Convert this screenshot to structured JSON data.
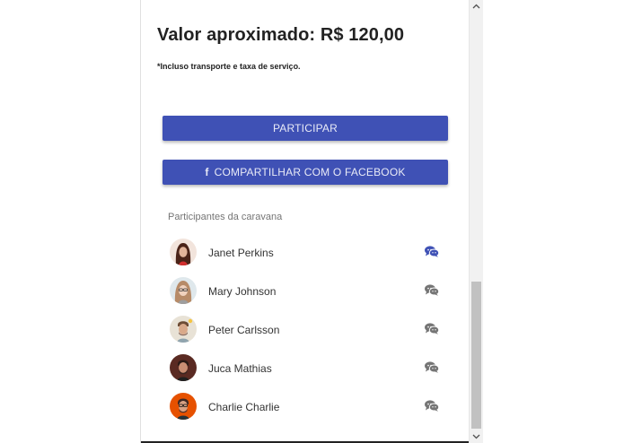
{
  "price": {
    "text": "Valor aproximado: R$ 120,00"
  },
  "note": {
    "text": "*Incluso transporte e taxa de serviço."
  },
  "buttons": {
    "participar": "PARTICIPAR",
    "facebook": "COMPARTILHAR COM O FACEBOOK",
    "facebook_icon": "f"
  },
  "participants": {
    "title": "Participantes da caravana",
    "items": [
      {
        "name": "Janet Perkins",
        "chat_color": "#3f51b5",
        "icon": "chat-bubbles-icon"
      },
      {
        "name": "Mary Johnson",
        "chat_color": "#757575",
        "icon": "chat-bubbles-icon"
      },
      {
        "name": "Peter Carlsson",
        "chat_color": "#757575",
        "icon": "chat-bubbles-icon"
      },
      {
        "name": "Juca Mathias",
        "chat_color": "#757575",
        "icon": "chat-bubbles-icon"
      },
      {
        "name": "Charlie Charlie",
        "chat_color": "#757575",
        "icon": "chat-bubbles-icon"
      }
    ]
  },
  "colors": {
    "primary": "#3f51b5",
    "text": "#222222",
    "muted": "#757575"
  }
}
